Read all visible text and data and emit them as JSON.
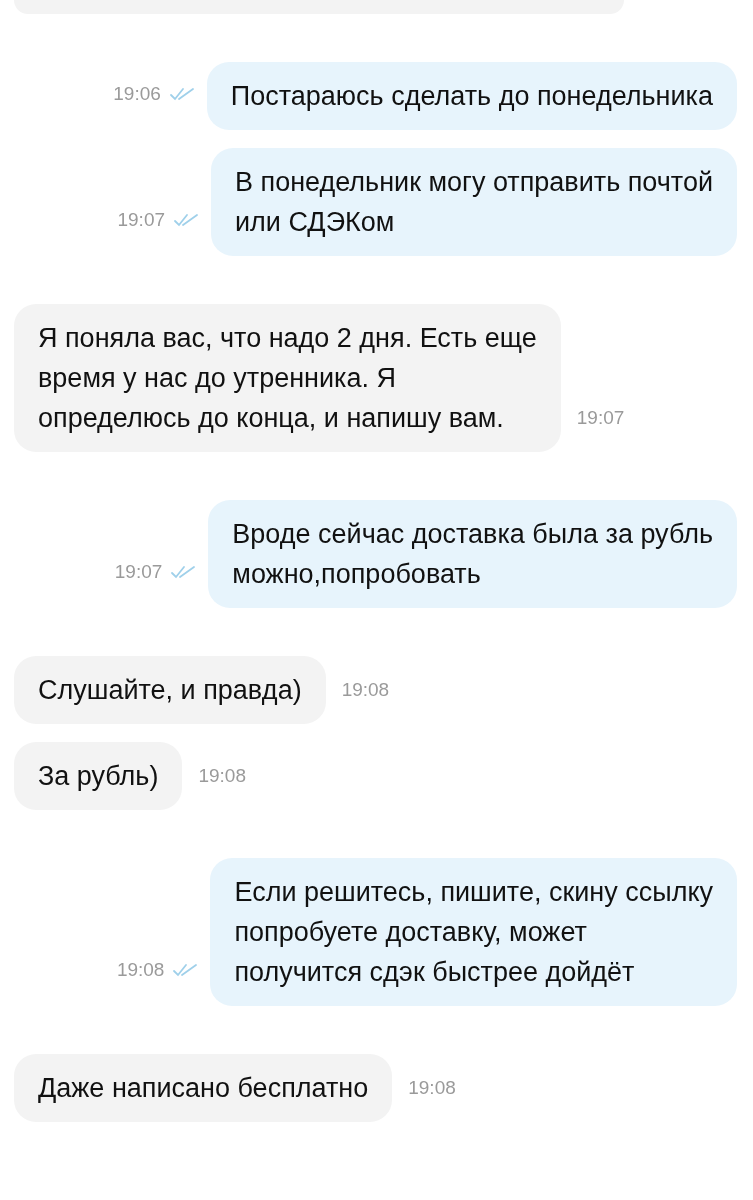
{
  "groups": [
    {
      "messages": [
        {
          "kind": "outgoing",
          "text": "Постараюсь сделать до понедельника",
          "time": "19:06",
          "read": true
        },
        {
          "kind": "outgoing",
          "text": "В понедельник могу отправить почтой\nили СДЭКом",
          "time": "19:07",
          "read": true
        }
      ]
    },
    {
      "messages": [
        {
          "kind": "incoming",
          "text": "Я поняла вас, что надо 2 дня. Есть еще\nвремя у нас до утренника. Я\nопределюсь до конца, и напишу вам.",
          "time": "19:07"
        }
      ]
    },
    {
      "messages": [
        {
          "kind": "outgoing",
          "text": "Вроде сейчас доставка была за рубль\nможно,попробовать",
          "time": "19:07",
          "read": true
        }
      ]
    },
    {
      "messages": [
        {
          "kind": "incoming",
          "text": "Слушайте, и правда)",
          "time": "19:08"
        },
        {
          "kind": "incoming",
          "text": "За рубль)",
          "time": "19:08"
        }
      ]
    },
    {
      "messages": [
        {
          "kind": "outgoing",
          "text": "Если решитесь, пишите, скину ссылку\nпопробуете доставку, может\nполучится сдэк быстрее дойдёт",
          "time": "19:08",
          "read": true
        }
      ]
    },
    {
      "messages": [
        {
          "kind": "incoming",
          "text": "Даже написано бесплатно",
          "time": "19:08"
        }
      ]
    }
  ]
}
